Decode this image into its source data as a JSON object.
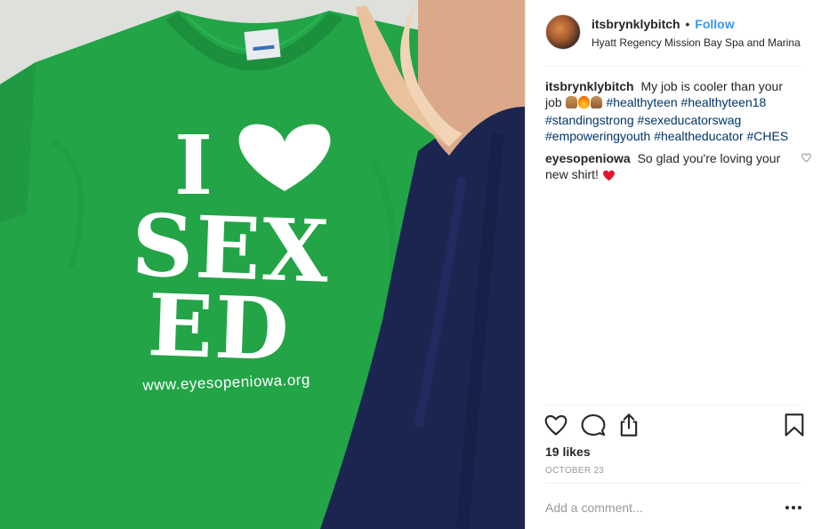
{
  "post": {
    "photo": {
      "shirt_line1": "I",
      "shirt_line2": "SEX",
      "shirt_line3": "ED",
      "shirt_url": "www.eyesopeniowa.org",
      "colors": {
        "shirt": "#22a447",
        "jeans": "#1b2550",
        "shoe": "#e9c29c"
      }
    },
    "header": {
      "username": "itsbrynklybitch",
      "separator": "•",
      "follow_label": "Follow",
      "location": "Hyatt Regency Mission Bay Spa and Marina"
    },
    "caption": {
      "username": "itsbrynklybitch",
      "text": "My job is cooler than your job",
      "emoji_icons": [
        "fingers-crossed-emoji",
        "fire-emoji",
        "raised-hands-emoji"
      ],
      "hashtags": [
        "#healthyteen",
        "#healthyteen18",
        "#standingstrong",
        "#sexeducatorswag",
        "#empoweringyouth",
        "#healtheducator",
        "#CHES"
      ]
    },
    "comments": [
      {
        "username": "eyesopeniowa",
        "text": "So glad you're loving your new shirt!",
        "emoji_icon": "red-heart-emoji"
      }
    ],
    "actions": {
      "like_icon": "heart-outline-icon",
      "comment_icon": "speech-bubble-icon",
      "share_icon": "share-upload-icon",
      "save_icon": "bookmark-icon"
    },
    "likes": "19 likes",
    "date": "OCTOBER 23",
    "comment_input": {
      "placeholder": "Add a comment...",
      "value": ""
    },
    "more_icon": "ellipsis-icon",
    "colors": {
      "link": "#3897f0",
      "hashtag": "#003569",
      "muted": "#999999",
      "text": "#262626"
    }
  }
}
